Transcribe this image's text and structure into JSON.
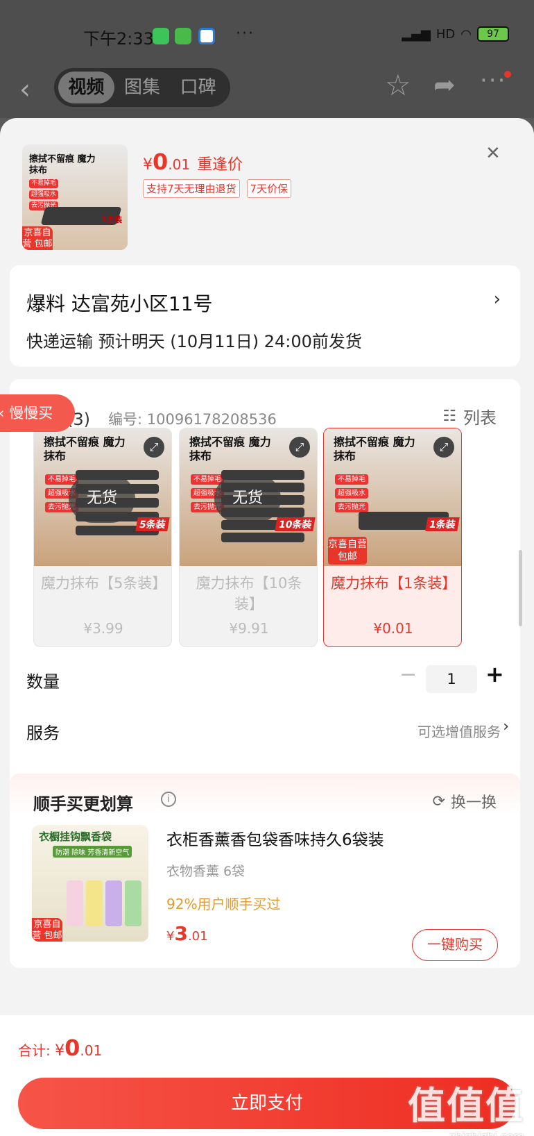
{
  "status_bar": {
    "time": "下午2:33",
    "dots": "···",
    "network": "HD",
    "battery": "97"
  },
  "nav": {
    "tabs": [
      "视频",
      "图集",
      "口碑"
    ],
    "active_tab": 0
  },
  "product": {
    "thumb_title": "擦拭不留痕 魔力抹布",
    "thumb_tags": [
      "不易掉毛",
      "超强吸水",
      "去污抛光"
    ],
    "thumb_count": "1条装",
    "badge": "京喜自营 包邮",
    "price_yen": "¥",
    "price_int": "0",
    "price_dec": ".01",
    "price_label": "重逢价",
    "promo_tags": [
      "支持7天无理由退货",
      "7天价保"
    ]
  },
  "address": {
    "line": "爆料  达富苑小区11号",
    "shipping": "快递运输 预计明天 (10月11日) 24:00前发货"
  },
  "spec": {
    "heading": "规格(3)",
    "sku": "编号: 10096178208536",
    "list_label": "列表",
    "slow_buy": "慢慢买",
    "variants": [
      {
        "title": "擦拭不留痕 魔力抹布",
        "count": "5条装",
        "status": "无货",
        "name": "魔力抹布【5条装】",
        "price": "¥3.99"
      },
      {
        "title": "擦拭不留痕 魔力抹布",
        "count": "10条装",
        "status": "无货",
        "name": "魔力抹布【10条装】",
        "price": "¥9.91"
      },
      {
        "title": "擦拭不留痕 魔力抹布",
        "count": "1条装",
        "badge": "京喜自营 包邮",
        "name": "魔力抹布【1条装】",
        "price": "¥0.01"
      }
    ],
    "selected_index": 2,
    "variant_tags": [
      "不易掉毛",
      "超强吸水",
      "去污抛光"
    ]
  },
  "quantity": {
    "label": "数量",
    "value": "1",
    "minus": "−",
    "plus": "+"
  },
  "service": {
    "label": "服务",
    "value": "可选增值服务"
  },
  "upsell": {
    "title": "顺手买更划算",
    "refresh_label": "换一换",
    "img_title": "衣橱挂钩飘香袋",
    "img_sub": "防潮 除味 芳香清新空气",
    "img_badge": "京喜自营 包邮",
    "name": "衣柜香薰香包袋香味持久6袋装",
    "sub": "衣物香薰 6袋",
    "percent": "92%用户顺手买过",
    "price_yen": "¥",
    "price_int": "3",
    "price_dec": ".01",
    "buy_label": "一键购买"
  },
  "footer": {
    "total_label": "合计: ",
    "total_yen": "¥",
    "total_int": "0",
    "total_dec": ".01",
    "pay_label": "立即支付"
  },
  "watermark": {
    "big": "值值值",
    "small": "zhizhizhi.com"
  },
  "colors": {
    "accent": "#e8362a",
    "orange": "#e59a2a"
  }
}
